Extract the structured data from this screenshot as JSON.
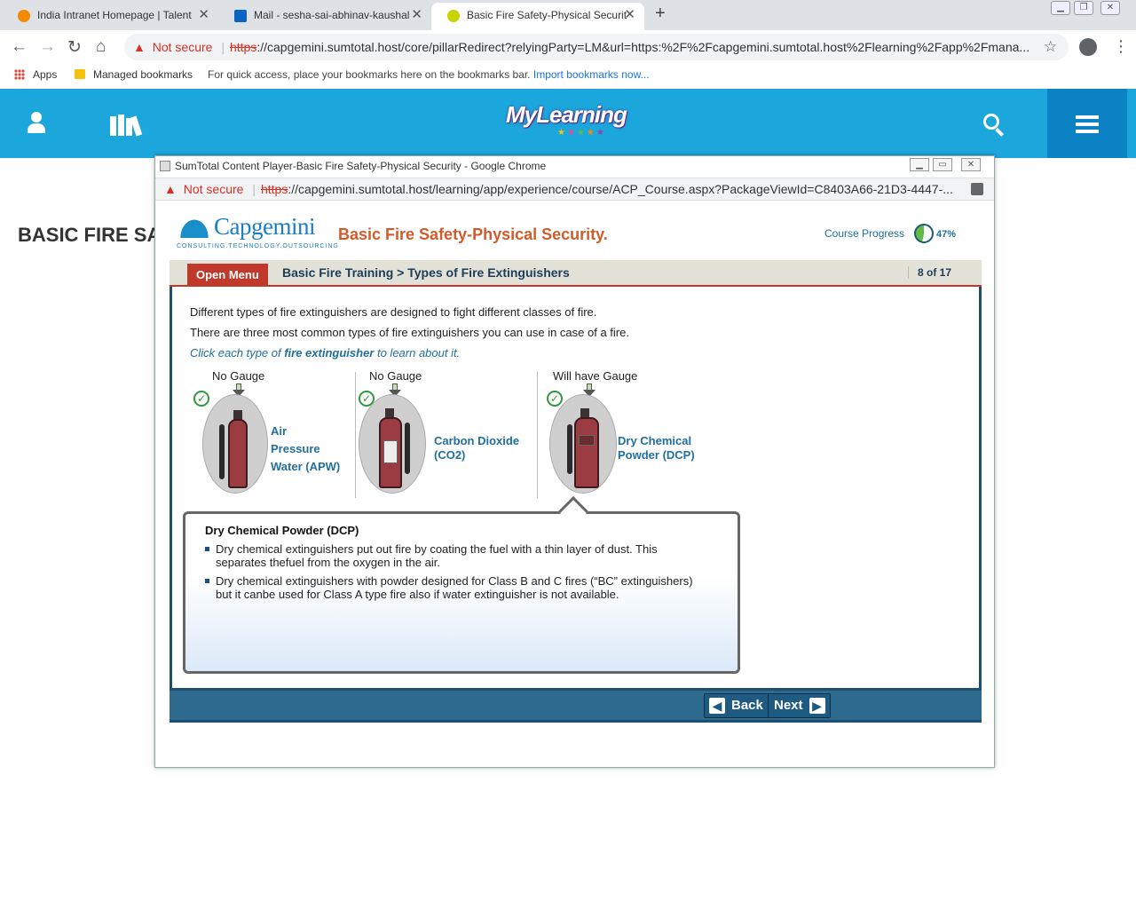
{
  "browser": {
    "tabs": [
      {
        "label": "India Intranet Homepage | Talent",
        "favicon_color": "#f28b00"
      },
      {
        "label": "Mail - sesha-sai-abhinav-kaushal",
        "favicon_color": "#0a64c2"
      },
      {
        "label": "Basic Fire Safety-Physical Security",
        "favicon_color": "#c8d400"
      }
    ],
    "security": "Not secure",
    "url_scheme": "https",
    "url_rest": "://capgemini.sumtotal.host/core/pillarRedirect?relyingParty=LM&url=https:%2F%2Fcapgemini.sumtotal.host%2Flearning%2Fapp%2Fmana...",
    "bookmarks": {
      "apps": "Apps",
      "managed": "Managed bookmarks",
      "hint": "For quick access, place your bookmarks here on the bookmarks bar.",
      "import": "Import bookmarks now..."
    }
  },
  "mylearning": {
    "logo": "MyLearning",
    "page_title": "BASIC FIRE SAI"
  },
  "popup": {
    "title": "SumTotal Content Player-Basic Fire Safety-Physical Security - Google Chrome",
    "security": "Not secure",
    "url_scheme": "https",
    "url_rest": "://capgemini.sumtotal.host/learning/app/experience/course/ACP_Course.aspx?PackageViewId=C8403A66-21D3-4447-..."
  },
  "course": {
    "brand": "Capgemini",
    "brand_tag": "CONSULTING.TECHNOLOGY.OUTSOURCING",
    "title": "Basic Fire Safety-Physical Security.",
    "progress_label": "Course Progress",
    "progress_pct": "47%",
    "progress_value": 0.47,
    "open_menu": "Open Menu",
    "breadcrumb": "Basic Fire Training > Types of Fire Extinguishers",
    "page_count": "8 of 17",
    "intro_1": "Different types of fire extinguishers are designed to fight different classes of fire.",
    "intro_2": "There are three most common types of fire extinguishers you can use in case of a fire.",
    "instruction_pre": "Click each type of ",
    "instruction_bold": "fire extinguisher",
    "instruction_post": " to learn about it.",
    "extinguishers": [
      {
        "gauge": "No Gauge",
        "name_lines": [
          "Air",
          "Pressure",
          "Water (APW)"
        ]
      },
      {
        "gauge": "No Gauge",
        "name_lines": [
          "Carbon Dioxide",
          "(CO2)"
        ]
      },
      {
        "gauge": "Will have Gauge",
        "name_lines": [
          "Dry Chemical",
          "Powder (DCP)"
        ]
      }
    ],
    "callout": {
      "title": "Dry Chemical Powder (DCP)",
      "bullets": [
        "Dry chemical extinguishers put out fire by coating the fuel with a thin layer of dust. This separates thefuel from the oxygen in the air.",
        "Dry chemical extinguishers with powder designed for Class B and C fires (“BC” extinguishers) but it canbe used for Class A type fire also if water extinguisher is not available."
      ]
    },
    "back": "Back",
    "next": "Next"
  }
}
